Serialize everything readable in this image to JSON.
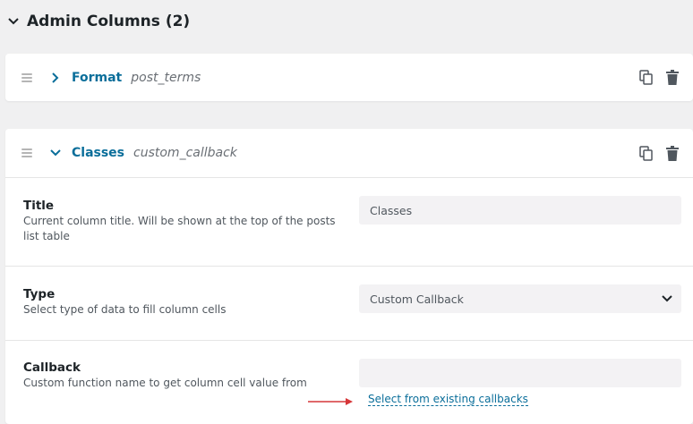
{
  "section": {
    "title": "Admin Columns (2)"
  },
  "columns": [
    {
      "label": "Format",
      "type": "post_terms",
      "expanded": false
    },
    {
      "label": "Classes",
      "type": "custom_callback",
      "expanded": true
    }
  ],
  "fields": {
    "title": {
      "label": "Title",
      "description": "Current column title. Will be shown at the top of the posts list table",
      "value": "Classes"
    },
    "type": {
      "label": "Type",
      "description": "Select type of data to fill column cells",
      "value": "Custom Callback"
    },
    "callback": {
      "label": "Callback",
      "description": "Custom function name to get column cell value from",
      "value": "",
      "link": "Select from existing callbacks"
    }
  },
  "colors": {
    "accent": "#0a6e9a",
    "arrow": "#d63638"
  },
  "icons": [
    "chevron-down-icon",
    "chevron-right-icon",
    "drag-handle-icon",
    "duplicate-icon",
    "trash-icon",
    "select-caret-icon"
  ]
}
